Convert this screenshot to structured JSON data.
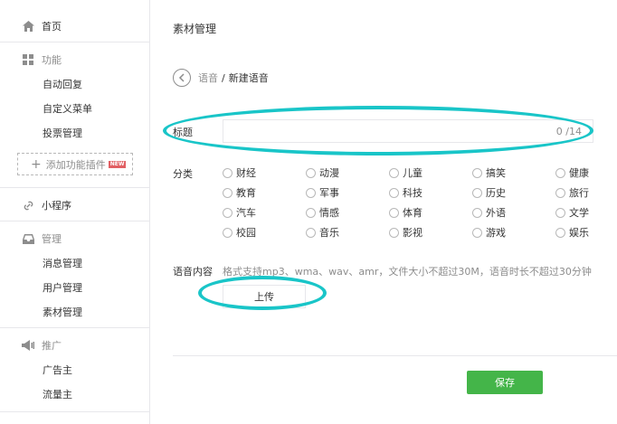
{
  "sidebar": {
    "home": {
      "icon": "home-icon",
      "label": "首页"
    },
    "features": {
      "icon": "grid-icon",
      "label": "功能",
      "items": [
        "自动回复",
        "自定义菜单",
        "投票管理"
      ]
    },
    "add_plugin": {
      "label": "添加功能插件",
      "badge": "NEW"
    },
    "miniprogram": {
      "icon": "link-icon",
      "label": "小程序"
    },
    "manage": {
      "icon": "inbox-icon",
      "label": "管理",
      "items": [
        "消息管理",
        "用户管理",
        "素材管理"
      ]
    },
    "promote": {
      "icon": "megaphone-icon",
      "label": "推广",
      "items": [
        "广告主",
        "流量主"
      ]
    }
  },
  "main": {
    "page_title": "素材管理",
    "breadcrumb": {
      "parent": "语音",
      "separator": "/",
      "current": "新建语音"
    },
    "title_field": {
      "label": "标题",
      "value": "",
      "count": "0 /14"
    },
    "category": {
      "label": "分类",
      "options": [
        [
          "财经",
          "动漫",
          "儿童",
          "搞笑",
          "健康"
        ],
        [
          "教育",
          "军事",
          "科技",
          "历史",
          "旅行"
        ],
        [
          "汽车",
          "情感",
          "体育",
          "外语",
          "文学"
        ],
        [
          "校园",
          "音乐",
          "影视",
          "游戏",
          "娱乐"
        ]
      ]
    },
    "voice": {
      "label": "语音内容",
      "hint": "格式支持mp3、wma、wav、amr，文件大小不超过30M，语音时长不超过30分钟",
      "upload_label": "上传"
    },
    "save_label": "保存"
  },
  "colors": {
    "accent": "#44b549",
    "annotation": "#19c5c8",
    "badge": "#e15f63"
  }
}
